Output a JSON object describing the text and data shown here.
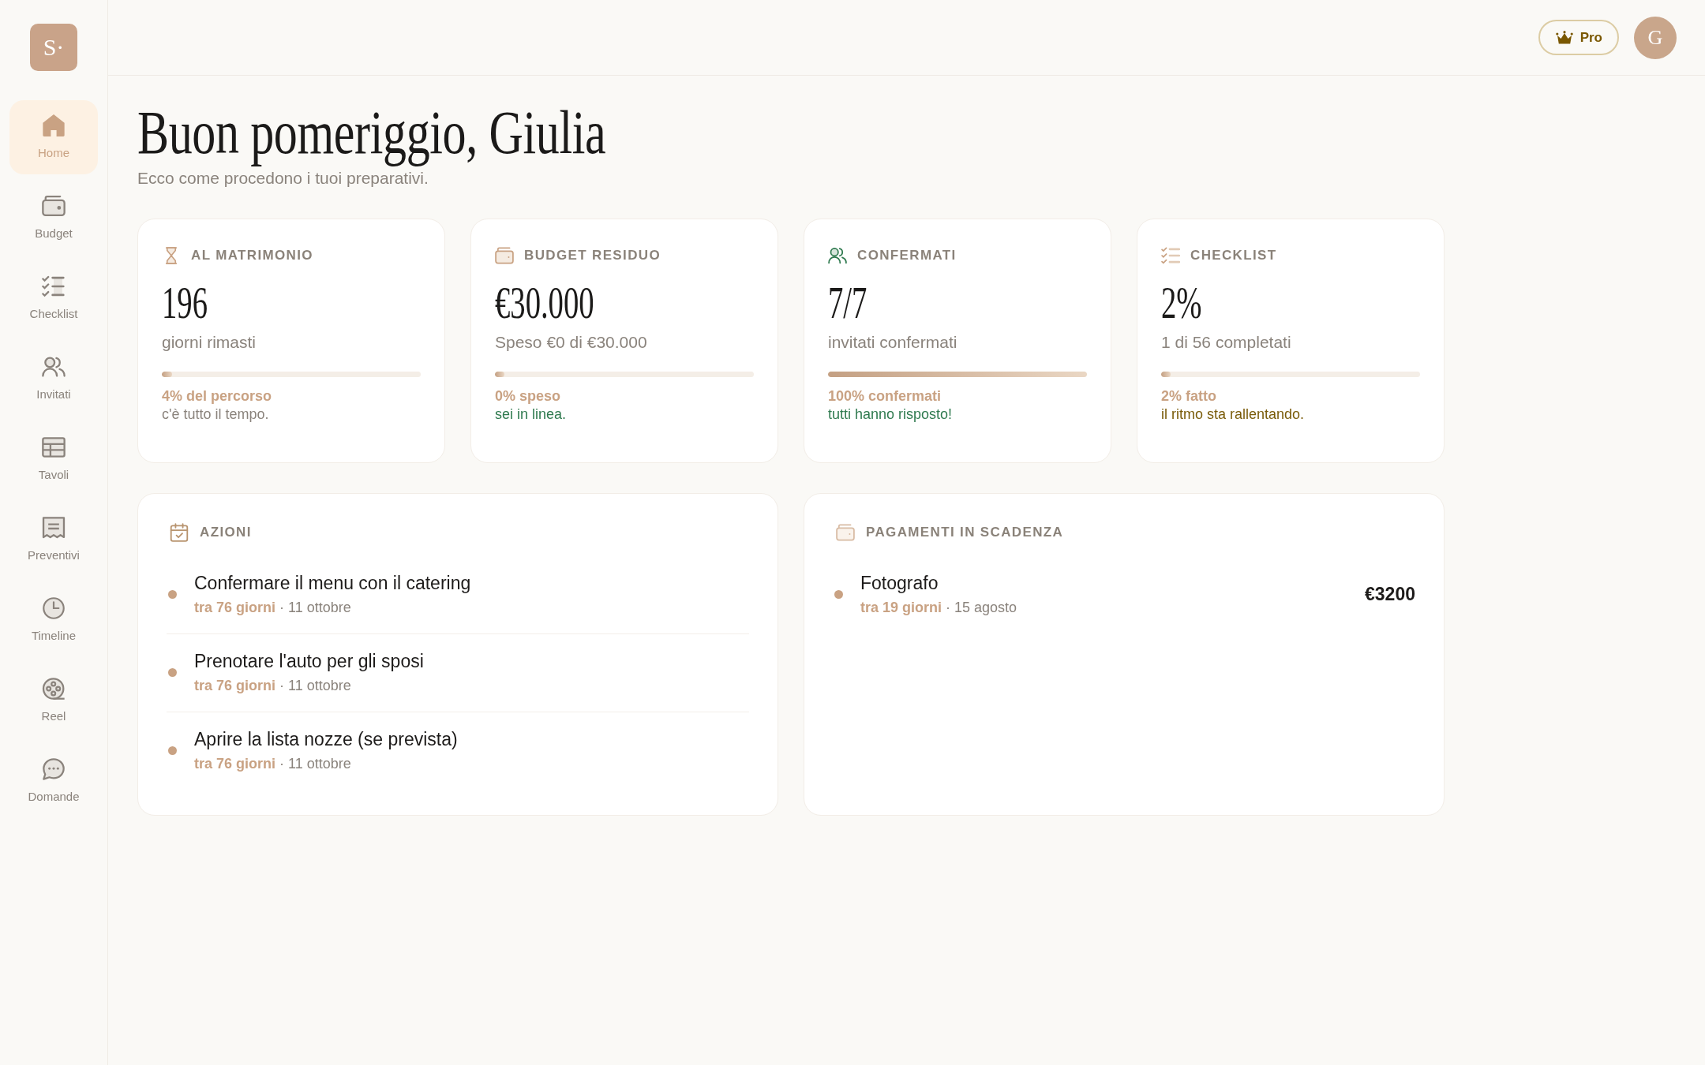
{
  "sidebar": {
    "logo": "S·",
    "items": [
      {
        "label": "Home",
        "kind": "home",
        "selected": true
      },
      {
        "label": "Budget",
        "kind": "budget",
        "selected": false
      },
      {
        "label": "Checklist",
        "kind": "checklist",
        "selected": false
      },
      {
        "label": "Invitati",
        "kind": "guests",
        "selected": false
      },
      {
        "label": "Tavoli",
        "kind": "tables",
        "selected": false
      },
      {
        "label": "Preventivi",
        "kind": "quotes",
        "selected": false
      },
      {
        "label": "Timeline",
        "kind": "timeline",
        "selected": false
      },
      {
        "label": "Reel",
        "kind": "reel",
        "selected": false
      },
      {
        "label": "Domande",
        "kind": "questions",
        "selected": false
      }
    ]
  },
  "header": {
    "plan_button": "Pro",
    "avatar": "G"
  },
  "greeting": {
    "title": "Buon pomeriggio, Giulia",
    "subtitle": "Ecco come procedono i tuoi preparativi."
  },
  "stats": [
    {
      "kind": "countdown",
      "label": "AL MATRIMONIO",
      "value": "196",
      "caption": "giorni rimasti",
      "level": 0.04,
      "progress_text": "4% del percorso",
      "note": "c'è tutto il tempo.",
      "color": "#8a837c"
    },
    {
      "kind": "budget",
      "label": "BUDGET RESIDUO",
      "value": "€30.000",
      "caption": "Speso €0 di €30.000",
      "level": 0,
      "progress_text": "0% speso",
      "note": "sei in linea.",
      "color": "#2f7a4f"
    },
    {
      "kind": "guests",
      "label": "CONFERMATI",
      "value": "7/7",
      "caption": "invitati confermati",
      "level": 1,
      "progress_text": "100% confermati",
      "note": "tutti hanno risposto!",
      "color": "#2f7a4f"
    },
    {
      "kind": "checklist",
      "label": "CHECKLIST",
      "value": "2%",
      "caption": "1 di 56 completati",
      "level": 0.02,
      "progress_text": "2% fatto",
      "note": "il ritmo sta rallentando.",
      "color": "#7a5c0a"
    }
  ],
  "actions": {
    "title": "AZIONI",
    "items": [
      {
        "title": "Confermare il menu con il catering",
        "meta": "**tra 76 giorni** · 11 ottobre"
      },
      {
        "title": "Prenotare l'auto per gli sposi",
        "meta": "**tra 76 giorni** · 11 ottobre"
      },
      {
        "title": "Aprire la lista nozze (se prevista)",
        "meta": "**tra 76 giorni** · 11 ottobre"
      }
    ]
  },
  "payments": {
    "title": "PAGAMENTI IN SCADENZA",
    "items": [
      {
        "title": "Fotografo",
        "meta": "**tra 19 giorni** · 15 agosto",
        "amount": "€3200"
      }
    ]
  }
}
